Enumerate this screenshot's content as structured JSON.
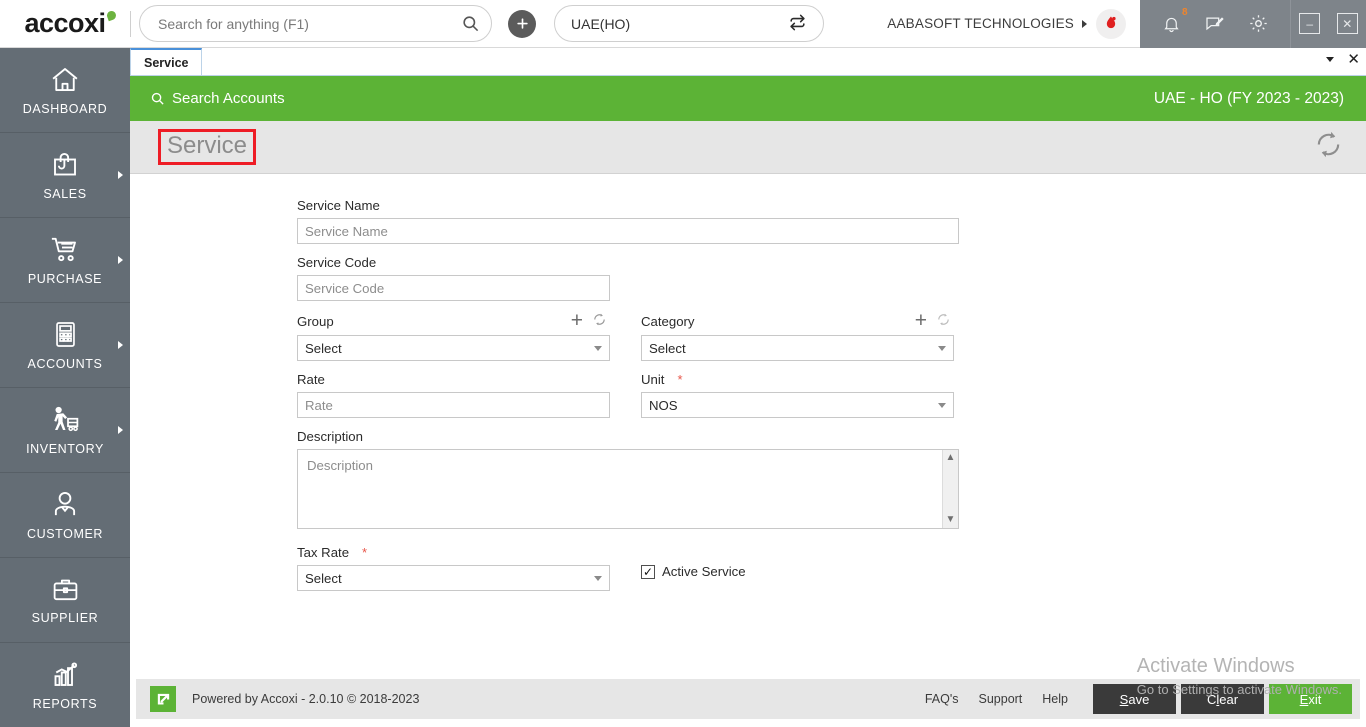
{
  "app": {
    "logo_text": "accoxi",
    "brand_green": "#5cb336",
    "sidebar_gray": "#646d75",
    "accent_red": "#ee1c25"
  },
  "topbar": {
    "search": {
      "placeholder": "Search for anything (F1)",
      "value": ""
    },
    "add_label": "+",
    "branch": {
      "value": "UAE(HO)",
      "swap_icon": "swap-icon"
    },
    "company": "AABASOFT TECHNOLOGIES",
    "notification_count": "8",
    "icons": {
      "search": "search-icon",
      "bell": "bell-icon",
      "message": "message-icon",
      "settings": "gear-icon",
      "minimize": "minimize-icon",
      "close": "close-icon"
    }
  },
  "sidebar": {
    "items": [
      {
        "label": "DASHBOARD",
        "icon": "home-icon",
        "has_arrow": false
      },
      {
        "label": "SALES",
        "icon": "shopping-bag-icon",
        "has_arrow": true
      },
      {
        "label": "PURCHASE",
        "icon": "shopping-cart-icon",
        "has_arrow": true
      },
      {
        "label": "ACCOUNTS",
        "icon": "calculator-icon",
        "has_arrow": true
      },
      {
        "label": "INVENTORY",
        "icon": "forklift-icon",
        "has_arrow": true
      },
      {
        "label": "CUSTOMER",
        "icon": "user-icon",
        "has_arrow": false
      },
      {
        "label": "SUPPLIER",
        "icon": "briefcase-icon",
        "has_arrow": false
      },
      {
        "label": "REPORTS",
        "icon": "bar-chart-icon",
        "has_arrow": false
      }
    ]
  },
  "tabs": {
    "items": [
      {
        "label": "Service",
        "active": true
      }
    ],
    "dropdown_icon": "chevron-down-icon",
    "close_icon": "close-icon"
  },
  "greenbar": {
    "search_accounts": "Search Accounts",
    "fiscal_year": "UAE - HO (FY 2023 - 2023)"
  },
  "page": {
    "title": "Service",
    "refresh_icon": "refresh-icon"
  },
  "form": {
    "service_name": {
      "label": "Service Name",
      "placeholder": "Service Name",
      "value": ""
    },
    "service_code": {
      "label": "Service Code",
      "placeholder": "Service Code",
      "value": ""
    },
    "group": {
      "label": "Group",
      "value": "Select",
      "add_icon": "plus-icon",
      "refresh_icon": "refresh-icon"
    },
    "category": {
      "label": "Category",
      "value": "Select",
      "add_icon": "plus-icon",
      "refresh_icon": "refresh-icon"
    },
    "rate": {
      "label": "Rate",
      "placeholder": "Rate",
      "value": ""
    },
    "unit": {
      "label": "Unit",
      "value": "NOS",
      "required": "*"
    },
    "description": {
      "label": "Description",
      "placeholder": "Description",
      "value": ""
    },
    "tax_rate": {
      "label": "Tax Rate",
      "value": "Select",
      "required": "*"
    },
    "active_service": {
      "label": "Active Service",
      "checked": true,
      "check_glyph": "✓"
    }
  },
  "footer": {
    "powered_by": "Powered by Accoxi - 2.0.10 © 2018-2023",
    "links": [
      "FAQ's",
      "Support",
      "Help"
    ],
    "buttons": [
      {
        "label": "Save",
        "accel": "S",
        "style": "dark"
      },
      {
        "label": "Clear",
        "accel": "l",
        "style": "dark"
      },
      {
        "label": "Exit",
        "accel": "E",
        "style": "green"
      }
    ]
  },
  "watermark": {
    "line1": "Activate Windows",
    "line2": "Go to Settings to activate Windows."
  }
}
